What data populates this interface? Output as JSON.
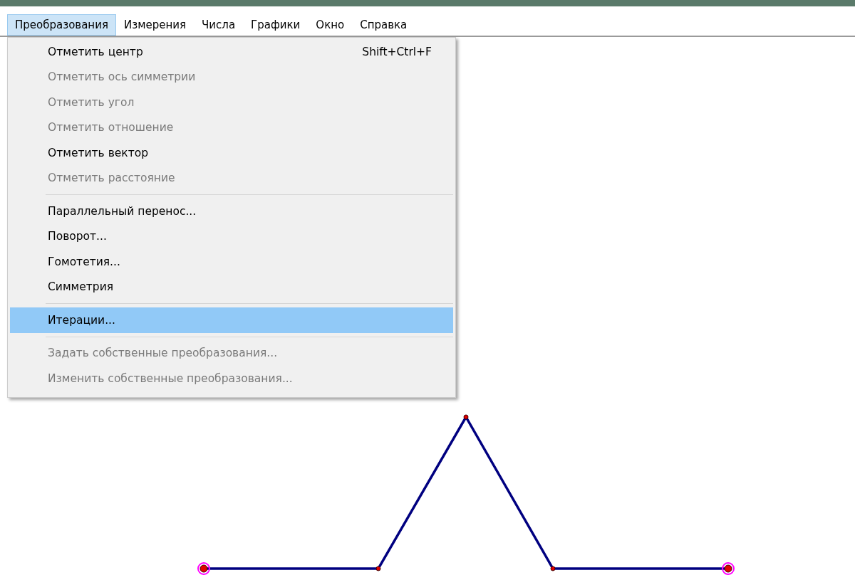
{
  "menubar": [
    {
      "label": "Преобразования",
      "selected": true
    },
    {
      "label": "Измерения",
      "selected": false
    },
    {
      "label": "Числа",
      "selected": false
    },
    {
      "label": "Графики",
      "selected": false
    },
    {
      "label": "Окно",
      "selected": false
    },
    {
      "label": "Справка",
      "selected": false
    }
  ],
  "menu": [
    {
      "kind": "item",
      "label": "Отметить центр",
      "shortcut": "Shift+Ctrl+F",
      "disabled": false,
      "selected": false
    },
    {
      "kind": "item",
      "label": "Отметить ось симметрии",
      "disabled": true,
      "selected": false
    },
    {
      "kind": "item",
      "label": "Отметить угол",
      "disabled": true,
      "selected": false
    },
    {
      "kind": "item",
      "label": "Отметить отношение",
      "disabled": true,
      "selected": false
    },
    {
      "kind": "item",
      "label": "Отметить вектор",
      "disabled": false,
      "selected": false
    },
    {
      "kind": "item",
      "label": "Отметить расстояние",
      "disabled": true,
      "selected": false
    },
    {
      "kind": "separator"
    },
    {
      "kind": "item",
      "label": "Параллельный перенос...",
      "disabled": false,
      "selected": false
    },
    {
      "kind": "item",
      "label": "Поворот...",
      "disabled": false,
      "selected": false
    },
    {
      "kind": "item",
      "label": "Гомотетия...",
      "disabled": false,
      "selected": false
    },
    {
      "kind": "item",
      "label": "Симметрия",
      "disabled": false,
      "selected": false
    },
    {
      "kind": "separator"
    },
    {
      "kind": "item",
      "label": "Итерации...",
      "disabled": false,
      "selected": true
    },
    {
      "kind": "separator"
    },
    {
      "kind": "item",
      "label": "Задать собственные преобразования...",
      "disabled": true,
      "selected": false
    },
    {
      "kind": "item",
      "label": "Изменить собственные преобразования...",
      "disabled": true,
      "selected": false
    }
  ]
}
